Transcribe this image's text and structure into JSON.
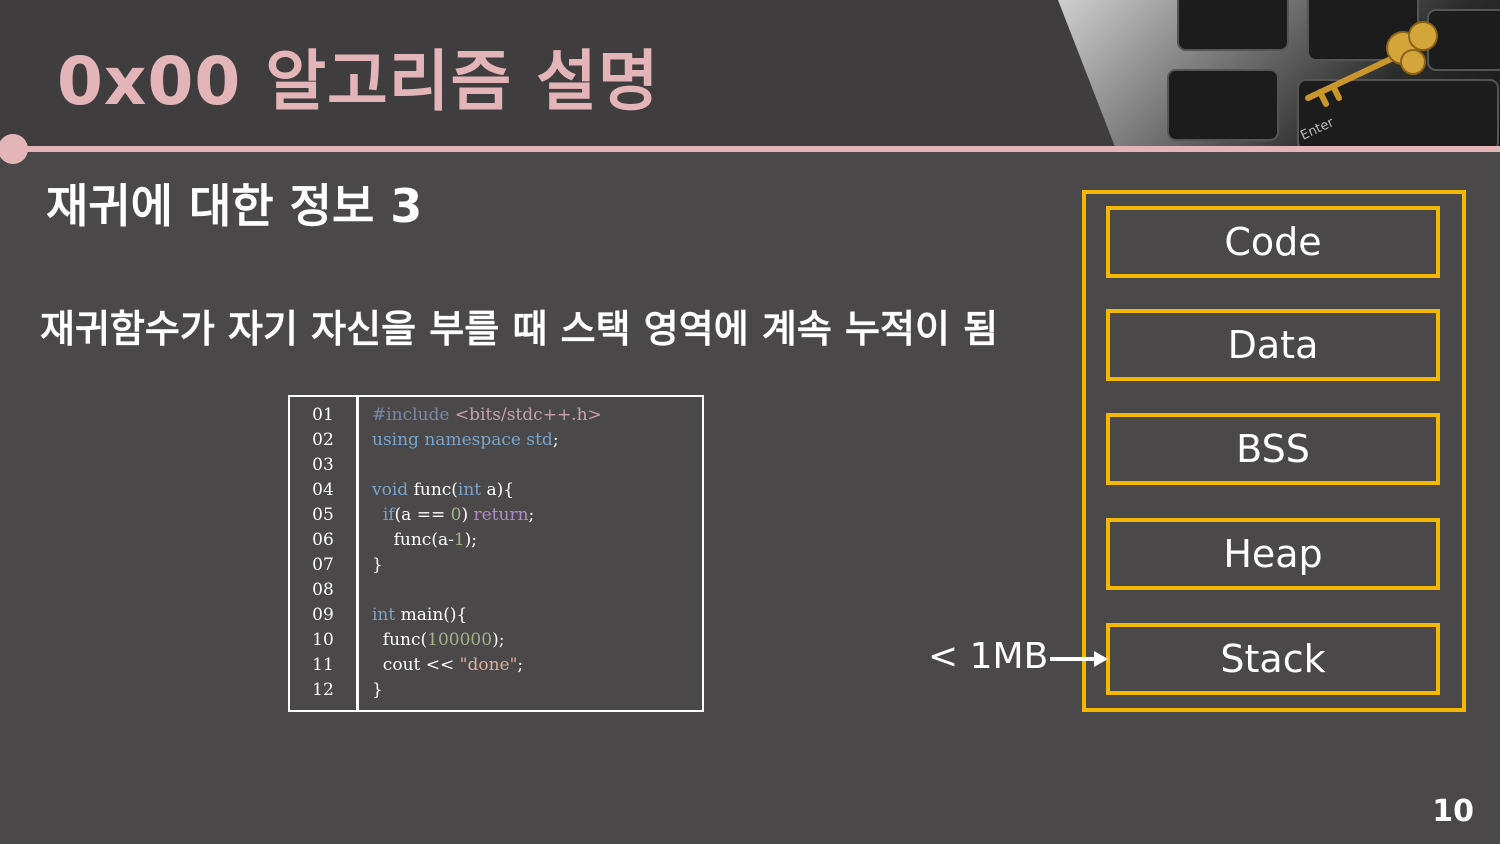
{
  "header": {
    "title": "0x00  알고리즘 설명"
  },
  "section_title": "재귀에 대한 정보 3",
  "description": "재귀함수가 자기 자신을 부를 때 스택 영역에 계속 누적이 됨",
  "code": {
    "line_numbers": [
      "01",
      "02",
      "03",
      "04",
      "05",
      "06",
      "07",
      "08",
      "09",
      "10",
      "11",
      "12"
    ],
    "lines": [
      "#include <bits/stdc++.h>",
      "using namespace std;",
      "",
      "void func(int a){",
      "  if(a == 0) return;",
      "    func(a-1);",
      "}",
      "",
      "int main(){",
      "  func(100000);",
      "  cout << \"done\";",
      "}"
    ]
  },
  "memory": {
    "segments": [
      "Code",
      "Data",
      "BSS",
      "Heap",
      "Stack"
    ],
    "stack_annotation": "< 1MB",
    "accent_color": "#f5b800"
  },
  "page_number": "10"
}
